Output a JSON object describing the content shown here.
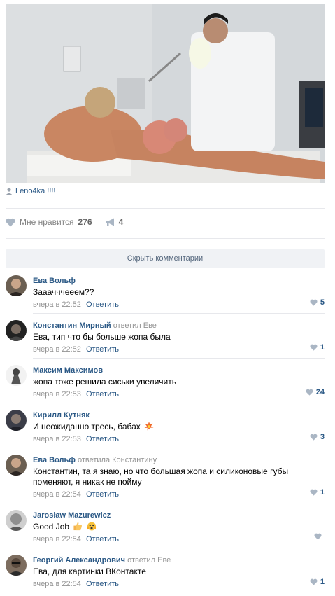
{
  "post": {
    "caption_text": "Leno4ka !!!!",
    "like_label": "Мне нравится",
    "like_count": "276",
    "share_count": "4"
  },
  "hide_comments_label": "Скрыть комментарии",
  "comments": [
    {
      "author": "Ева Вольф",
      "reply_to": "",
      "text": "Зааачччееем??",
      "time": "вчера в 22:52",
      "reply_label": "Ответить",
      "likes": "5"
    },
    {
      "author": "Константин Мирный",
      "reply_to": "ответил Еве",
      "text": "Ева, тип что бы больше жопа была",
      "time": "вчера в 22:52",
      "reply_label": "Ответить",
      "likes": "1"
    },
    {
      "author": "Максим Максимов",
      "reply_to": "",
      "text": "жопа тоже решила сиськи увеличить",
      "time": "вчера в 22:53",
      "reply_label": "Ответить",
      "likes": "24"
    },
    {
      "author": "Кирилл Кутняк",
      "reply_to": "",
      "text": "И неожиданно тресь, бабах",
      "time": "вчера в 22:53",
      "reply_label": "Ответить",
      "likes": "3"
    },
    {
      "author": "Ева Вольф",
      "reply_to": "ответила Константину",
      "text": "Константин, та я знаю, но что большая жопа и силиконовые губы поменяют, я никак не пойму",
      "time": "вчера в 22:54",
      "reply_label": "Ответить",
      "likes": "1"
    },
    {
      "author": "Jarosław Mazurewicz",
      "reply_to": "",
      "text": "Good Job",
      "time": "вчера в 22:54",
      "reply_label": "Ответить",
      "likes": ""
    },
    {
      "author": "Георгий Александрович",
      "reply_to": "ответил Еве",
      "text": "Ева, для картинки ВКонтакте",
      "time": "вчера в 22:54",
      "reply_label": "Ответить",
      "likes": "1"
    }
  ],
  "colors": {
    "link": "#2a5885",
    "muted": "#939393",
    "divider": "#e7e8ec",
    "button_bg": "#f0f2f5"
  }
}
